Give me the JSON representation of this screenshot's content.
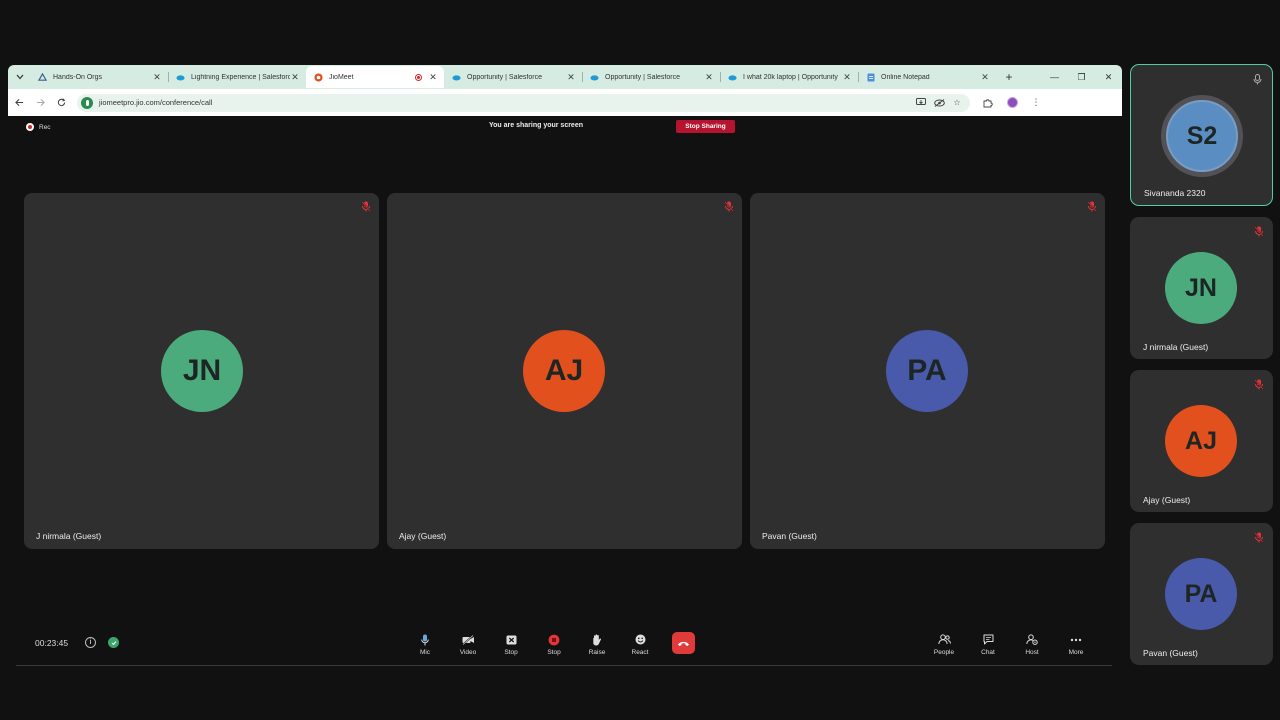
{
  "browser": {
    "tabs": [
      {
        "title": "Hands-On Orgs",
        "favicon": "trailhead-icon",
        "active": false,
        "recording": false
      },
      {
        "title": "Lightning Experience | Salesforce",
        "favicon": "salesforce-cloud-icon",
        "active": false,
        "recording": false
      },
      {
        "title": "JioMeet",
        "favicon": "jiomeet-icon",
        "active": true,
        "recording": true
      },
      {
        "title": "Opportunity | Salesforce",
        "favicon": "salesforce-cloud-icon",
        "active": false,
        "recording": false
      },
      {
        "title": "Opportunity | Salesforce",
        "favicon": "salesforce-cloud-icon",
        "active": false,
        "recording": false
      },
      {
        "title": "I what 20k laptop | Opportunity",
        "favicon": "salesforce-cloud-icon",
        "active": false,
        "recording": false
      },
      {
        "title": "Online Notepad",
        "favicon": "notepad-icon",
        "active": false,
        "recording": false
      }
    ],
    "url": "jiomeetpro.jio.com/conference/call"
  },
  "share_bar": {
    "rec_label": "Rec",
    "sharing_text": "You are sharing your screen",
    "stop_label": "Stop Sharing"
  },
  "tiles": [
    {
      "initials": "JN",
      "name": "J nirmala (Guest)",
      "color": "#4cab7d",
      "muted": true
    },
    {
      "initials": "AJ",
      "name": "Ajay (Guest)",
      "color": "#e2501e",
      "muted": true
    },
    {
      "initials": "PA",
      "name": "Pavan (Guest)",
      "color": "#4a5aaa",
      "muted": true
    }
  ],
  "sidebar": [
    {
      "initials": "S2",
      "name": "Sivananda 2320",
      "color": "#5a8ec2",
      "muted": false,
      "speaking": true
    },
    {
      "initials": "JN",
      "name": "J nirmala (Guest)",
      "color": "#4cab7d",
      "muted": true,
      "speaking": false
    },
    {
      "initials": "AJ",
      "name": "Ajay (Guest)",
      "color": "#e2501e",
      "muted": true,
      "speaking": false
    },
    {
      "initials": "PA",
      "name": "Pavan (Guest)",
      "color": "#4a5aaa",
      "muted": true,
      "speaking": false
    }
  ],
  "controls": {
    "timer": "00:23:45",
    "center": [
      {
        "label": "Mic",
        "icon": "mic-icon"
      },
      {
        "label": "Video",
        "icon": "video-off-icon"
      },
      {
        "label": "Stop",
        "icon": "stop-share-icon"
      },
      {
        "label": "Stop",
        "icon": "stop-recording-icon"
      },
      {
        "label": "Raise",
        "icon": "raise-hand-icon"
      },
      {
        "label": "React",
        "icon": "react-emoji-icon"
      }
    ],
    "right": [
      {
        "label": "People",
        "icon": "people-icon"
      },
      {
        "label": "Chat",
        "icon": "chat-icon"
      },
      {
        "label": "Host",
        "icon": "host-controls-icon"
      },
      {
        "label": "More",
        "icon": "more-icon"
      }
    ],
    "accent_end_call": "#e03a3a"
  }
}
